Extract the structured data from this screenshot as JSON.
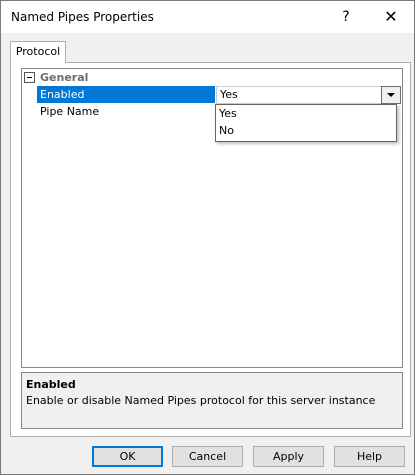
{
  "window": {
    "title": "Named Pipes Properties",
    "help_glyph": "?",
    "close_glyph": "✕"
  },
  "tabs": [
    {
      "label": "Protocol"
    }
  ],
  "grid": {
    "category": {
      "label": "General",
      "expander": "⊟"
    },
    "rows": [
      {
        "name": "Enabled",
        "value": "Yes",
        "selected": true
      },
      {
        "name": "Pipe Name",
        "value": ""
      }
    ]
  },
  "dropdown": {
    "options": [
      "Yes",
      "No"
    ]
  },
  "description": {
    "title": "Enabled",
    "text": "Enable or disable Named Pipes protocol for this server instance"
  },
  "buttons": {
    "ok": "OK",
    "cancel": "Cancel",
    "apply": "Apply",
    "help": "Help"
  },
  "colors": {
    "selection": "#0078d7",
    "dialog_bg": "#f0f0f0"
  }
}
